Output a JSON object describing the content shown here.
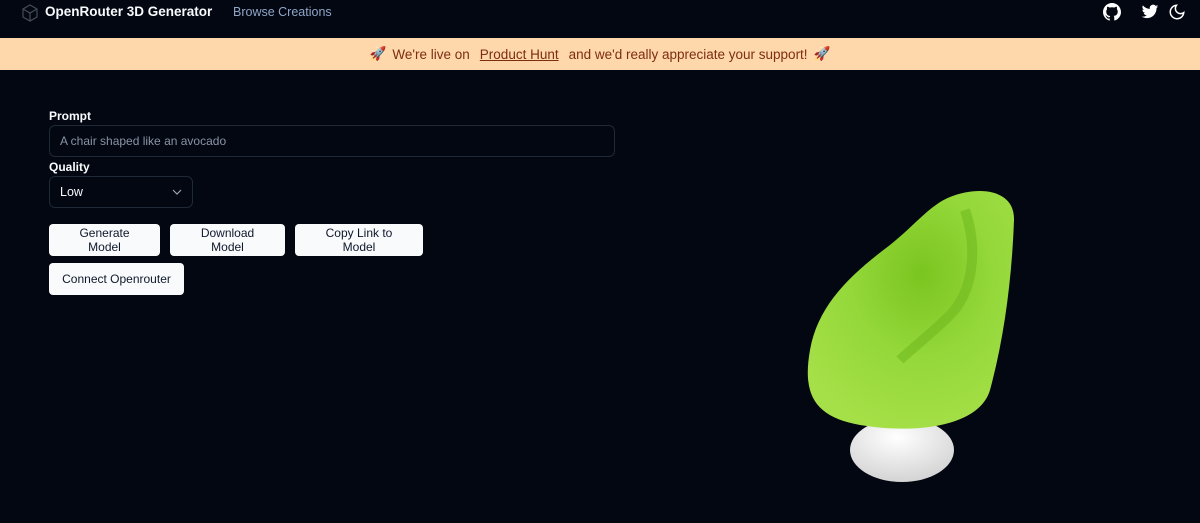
{
  "nav": {
    "title": "OpenRouter 3D Generator",
    "browse": "Browse Creations",
    "icons": [
      "cube-logo-icon",
      "github-icon",
      "twitter-icon",
      "moon-icon"
    ]
  },
  "banner": {
    "before": "We're live on",
    "link": "Product Hunt",
    "after": "and we'd really appreciate your support!",
    "emoji": "🚀",
    "bg": "#fed7aa"
  },
  "form": {
    "prompt_label": "Prompt",
    "prompt_placeholder": "A chair shaped like an avocado",
    "quality_label": "Quality",
    "quality_value": "Low"
  },
  "buttons": {
    "generate": "Generate Model",
    "download": "Download Model",
    "copy": "Copy Link to Model",
    "connect": "Connect Openrouter"
  },
  "colors": {
    "background": "#030712",
    "model_green": "#8fd630"
  }
}
